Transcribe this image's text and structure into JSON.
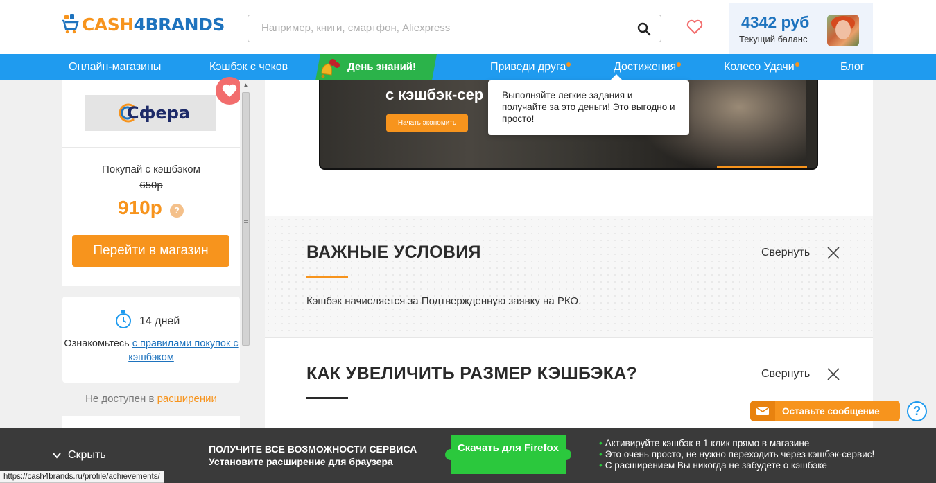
{
  "header": {
    "logo": {
      "part1": "CASH",
      "part2": "4BRANDS"
    },
    "search_placeholder": "Например, книги, смартфон, Aliexpress",
    "balance_amount": "4342 руб",
    "balance_label": "Текущий баланс"
  },
  "nav": {
    "items": [
      {
        "label": "Онлайн-магазины"
      },
      {
        "label": "Кэшбэк с чеков"
      },
      {
        "label": "Приведи друга"
      },
      {
        "label": "Достижения"
      },
      {
        "label": "Колесо Удачи"
      },
      {
        "label": "Блог"
      }
    ],
    "promo_label": "День знаний!"
  },
  "tooltip": {
    "text": "Выполняйте легкие задания и получайте за это деньги! Это выгодно и просто!"
  },
  "shop": {
    "name": "Сфера",
    "buy_label": "Покупай с кэшбэком",
    "old_price": "650р",
    "new_price": "910р",
    "help_symbol": "?",
    "go_button": "Перейти в магазин",
    "days": "14 дней",
    "rules_prefix": "Ознакомьтесь ",
    "rules_link": "с правилами покупок с кэшбэком",
    "ext_prefix": "Не доступен в ",
    "ext_link": "расширении"
  },
  "video": {
    "title": "с кэшбэк-сер",
    "button": "Начать экономить"
  },
  "sections": [
    {
      "title": "ВАЖНЫЕ УСЛОВИЯ",
      "collapse": "Свернуть",
      "text": "Кэшбэк начисляется за Подтвержденную заявку на РКО."
    },
    {
      "title": "КАК УВЕЛИЧИТЬ РАЗМЕР КЭШБЭКА?",
      "collapse": "Свернуть"
    }
  ],
  "chat": {
    "label": "Оставьте сообщение",
    "help": "?"
  },
  "bottom_bar": {
    "hide": "Скрыть",
    "title": "ПОЛУЧИТЕ ВСЕ ВОЗМОЖНОСТИ СЕРВИСА",
    "subtitle": "Установите расширение для браузера",
    "button": "Скачать для Firefox",
    "bullets": [
      "Активируйте кэшбэк в 1 клик прямо в магазине",
      "Это очень просто, не нужно переходить через кэшбэк-сервис!",
      "С расширением Вы никогда не забудете о кэшбэке"
    ]
  },
  "status_url": "https://cash4brands.ru/profile/achievements/",
  "colors": {
    "brand_blue": "#1f9bef",
    "brand_orange": "#f7941d",
    "promo_green": "#2bb34a",
    "firefox_green": "#2bc83d"
  }
}
